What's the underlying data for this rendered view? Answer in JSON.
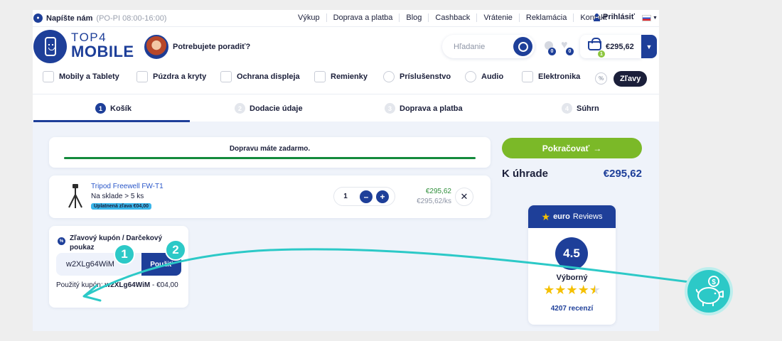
{
  "topbar": {
    "chat_label": "Napíšte nám",
    "chat_hours": "(PO-PI 08:00-16:00)",
    "links": [
      "Výkup",
      "Doprava a platba",
      "Blog",
      "Cashback",
      "Vrátenie",
      "Reklamácia",
      "Kontakt"
    ],
    "login_label": "Prihlásiť"
  },
  "header": {
    "logo_top": "TOP4",
    "logo_bottom": "MOBILE",
    "advisor_text": "Potrebujete poradiť?",
    "search_placeholder": "Hľadanie",
    "bulb_count": "0",
    "heart_count": "0",
    "cart_count": "1",
    "cart_price": "€295,62"
  },
  "categories": [
    {
      "label": "Mobily a Tablety",
      "icon": "phone-tablet-icon"
    },
    {
      "label": "Púzdra a kryty",
      "icon": "phone-case-icon"
    },
    {
      "label": "Ochrana displeja",
      "icon": "screen-protector-icon"
    },
    {
      "label": "Remienky",
      "icon": "watch-strap-icon"
    },
    {
      "label": "Príslušenstvo",
      "icon": "accessories-icon"
    },
    {
      "label": "Audio",
      "icon": "headphones-icon"
    },
    {
      "label": "Elektronika",
      "icon": "electronics-icon"
    }
  ],
  "sale_label": "Zľavy",
  "steps": [
    {
      "num": "1",
      "label": "Košík"
    },
    {
      "num": "2",
      "label": "Dodacie údaje"
    },
    {
      "num": "3",
      "label": "Doprava a platba"
    },
    {
      "num": "4",
      "label": "Súhrn"
    }
  ],
  "cart": {
    "free_shipping": "Dopravu máte zadarmo.",
    "free_shipping_progress": 1.0,
    "item": {
      "name": "Tripod Freewell FW-T1",
      "stock": "Na sklade > 5 ks",
      "discount_badge": "Uplatnená zľava €04,00",
      "quantity": "1",
      "price": "€295,62",
      "unit_price": "€295,62/ks"
    },
    "coupon": {
      "title": "Zľavový kupón / Darčekový poukaz",
      "code_value": "w2XLg64WiM",
      "apply_label": "Použiť",
      "used_prefix": "Použitý kupón:",
      "used_code": "w2XLg64WiM",
      "used_suffix": "- €04,00"
    }
  },
  "summary": {
    "continue_label": "Pokračovať",
    "total_label": "K úhrade",
    "total_value": "€295,62"
  },
  "reviews": {
    "brand_bold": "euro",
    "brand_rest": "Reviews",
    "score": "4.5",
    "rating_word": "Výborný",
    "stars": 4.5,
    "count": "4207 recenzí"
  },
  "annotations": {
    "callout_1": "1",
    "callout_2": "2"
  },
  "colors": {
    "brand_blue": "#1e3f99",
    "accent_green": "#7bb928",
    "teal_annotation": "#2cc9c7",
    "progress_green": "#138a3c"
  }
}
